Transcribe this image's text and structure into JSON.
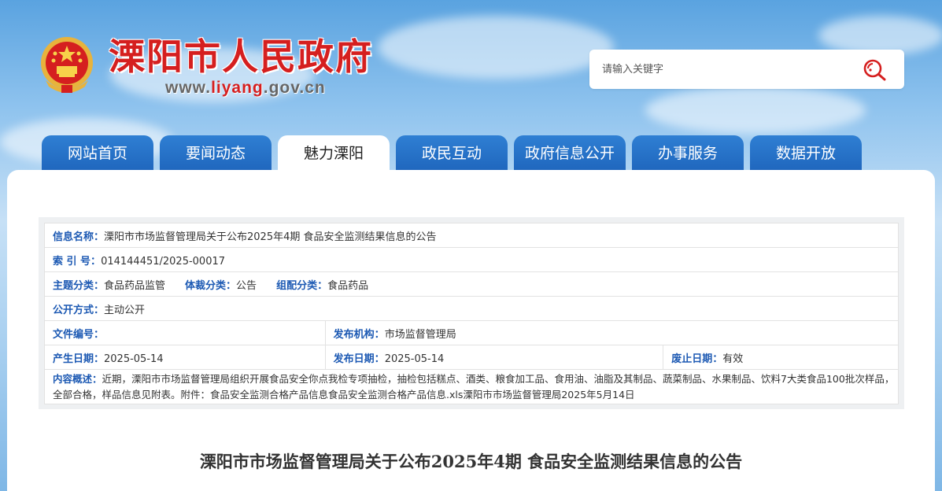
{
  "header": {
    "site_title": "溧阳市人民政府",
    "site_url_prefix": "www.",
    "site_url_highlight": "liyang",
    "site_url_suffix": ".gov.cn",
    "brand_color": "#d51f1f"
  },
  "search": {
    "placeholder": "请输入关键字",
    "value": "",
    "icon": "search-icon"
  },
  "nav": {
    "tabs": [
      {
        "label": "网站首页",
        "active": false
      },
      {
        "label": "要闻动态",
        "active": false
      },
      {
        "label": "魅力溧阳",
        "active": true
      },
      {
        "label": "政民互动",
        "active": false
      },
      {
        "label": "政府信息公开",
        "active": false
      },
      {
        "label": "办事服务",
        "active": false
      },
      {
        "label": "数据开放",
        "active": false
      }
    ],
    "tab_color": "#2f7fd3"
  },
  "info": {
    "name_label": "信息名称：",
    "name_value": "溧阳市市场监督管理局关于公布2025年4期 食品安全监测结果信息的公告",
    "index_label": "索 引 号：",
    "index_value": "014144451/2025-00017",
    "topic_label": "主题分类：",
    "topic_value": "食品药品监管",
    "genre_label": "体裁分类：",
    "genre_value": "公告",
    "group_label": "组配分类：",
    "group_value": "食品药品",
    "open_label": "公开方式：",
    "open_value": "主动公开",
    "docno_label": "文件编号：",
    "docno_value": "",
    "org_label": "发布机构：",
    "org_value": "市场监督管理局",
    "created_label": "产生日期：",
    "created_value": "2025-05-14",
    "published_label": "发布日期：",
    "published_value": "2025-05-14",
    "abolish_label": "废止日期：",
    "abolish_value": "有效",
    "summary_label": "内容概述：",
    "summary_value": "近期，溧阳市市场监督管理局组织开展食品安全你点我检专项抽检，抽检包括糕点、酒类、粮食加工品、食用油、油脂及其制品、蔬菜制品、水果制品、饮料7大类食品100批次样品，全部合格，样品信息见附表。附件：食品安全监测合格产品信息食品安全监测合格产品信息.xls溧阳市市场监督管理局2025年5月14日",
    "label_color": "#1c59b3"
  },
  "article": {
    "title": "溧阳市市场监督管理局关于公布2025年4期  食品安全监测结果信息的公告"
  }
}
